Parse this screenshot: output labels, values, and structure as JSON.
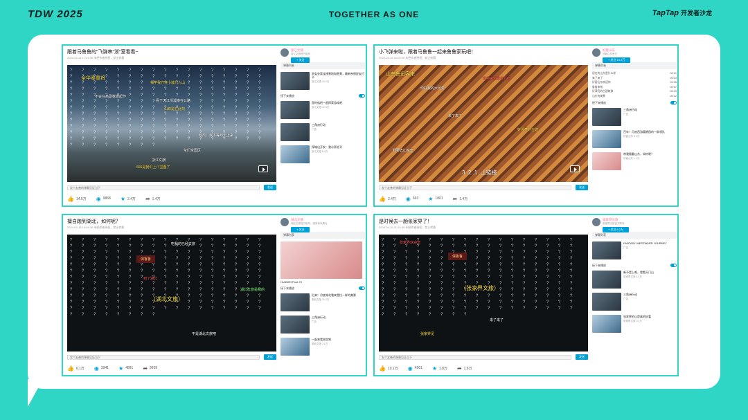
{
  "header": {
    "logo_left": "TDW 2025",
    "slogan": "TOGETHER AS ONE",
    "logo_right": "TapTap",
    "logo_right_sub": "开发者沙龙"
  },
  "panels": [
    {
      "title": "跟着马鲁鲁的\"飞弹串\"浙\"室看看~",
      "meta": "2024-04-18 17:33:38  未经作者授权，禁止转载",
      "danmaku": [
        "全华秦重将",
        "不会在高副数据起作",
        "我学我守住小城几人山",
        "看于天江浙溪淋在公路",
        "山峰是在此刻",
        "秋风，我不等到天上来",
        "666是我们上八宝图了",
        "爷们全国区",
        "浙江文旅!"
      ],
      "send_placeholder": "发个友善的弹幕见证当下",
      "send_label": "发送",
      "likes": "14.5万",
      "coins": "9868",
      "favs": "2.4万",
      "shares": "1.4万",
      "uploader": "浙江文旅",
      "uploader_desc": "浙江文旅官方账号",
      "follow": "+ 关注",
      "list_header": "弹幕列表",
      "autoplay": "接下来播放",
      "recs": [
        {
          "title": "浙女坐索连接景地和胜景，最新亲朋好友打卡",
          "sub": "浙江文旅  10.2万"
        },
        {
          "title": "是时候把一起探索游戏吧",
          "sub": "浙江文旅  12.3万"
        },
        {
          "title": "三角洲行动",
          "sub": "广告"
        },
        {
          "title": "探城出开发：我水原北寻",
          "sub": "浙江文旅  6.3万"
        }
      ]
    },
    {
      "title": "小飞弹来啦，跟着马鲁鲁一起来鲁鲁家玩吧！",
      "meta": "2024-04-19 18:00:00  未经作者授权，禁止转载",
      "danmaku": [
        "山东鲁迅客来",
        "你好我的大可爱",
        "欢迎来到曲阜孔府",
        "来了来了",
        "好漂亮的古建",
        "3..2..1..上链接",
        "我要去山东玩"
      ],
      "send_placeholder": "发个友善的弹幕见证当下",
      "send_label": "发送",
      "likes": "2.4万",
      "coins": "693",
      "favs": "1801",
      "shares": "1.4万",
      "uploader": "好客山东",
      "uploader_desc": "好客山东官方",
      "follow": "+ 关注 19.2万",
      "list_header": "弹幕列表",
      "autoplay": "接下来播放",
      "danmu_items": [
        {
          "text": "现在的山东是什么样",
          "time": "00:01"
        },
        {
          "text": "来了来了",
          "time": "00:03"
        },
        {
          "text": "好客山东欢迎你",
          "time": "00:05"
        },
        {
          "text": "鲁鲁来啦",
          "time": "00:07"
        },
        {
          "text": "好漂亮的古建筑群",
          "time": "00:09"
        },
        {
          "text": "山东有美景",
          "time": "00:12"
        }
      ],
      "recs": [
        {
          "title": "三角洲行动",
          "sub": "广告"
        },
        {
          "title": "百年！月底西游喜鹊园的一群领队",
          "sub": "好客山东  3.2万"
        },
        {
          "title": "带我看看山东，如何呢？",
          "sub": "好客山东  1.1万"
        }
      ]
    },
    {
      "title": "擅自跑到湖北，如何呢？",
      "meta": "2024-04-18 19:04:38  未经作者授权，禁止转载",
      "danmaku": [
        "保鲁鲁",
        "（湖北文旅）",
        "吃我的已经文旅",
        "到了湖北",
        "不是湖北文旅吧",
        "湖北文旅是我的"
      ],
      "send_placeholder": "发个友善的弹幕见证当下",
      "send_label": "发送",
      "likes": "6.1万",
      "coins": "3941",
      "favs": "4891",
      "shares": "9939",
      "uploader": "湖北文旅",
      "uploader_desc": "湖北文旅官方账号，邀请你来湖北",
      "follow": "+ 关注",
      "list_header": "弹幕列表",
      "autoplay": "接下来播放",
      "recs": [
        {
          "title": "HUAWEI Pura 70",
          "sub": "广告"
        },
        {
          "title": "后来！月底湖北看来是拉一样的美景",
          "sub": "湖北文旅  10.2万"
        },
        {
          "title": "三角洲行动",
          "sub": "广告"
        },
        {
          "title": "一起来看湖北吧",
          "sub": "湖北文旅  2.1万"
        }
      ]
    },
    {
      "title": "是时候去一趟张家界了！",
      "meta": "2024-04-19 21:10:38  未经作者授权，禁止转载",
      "danmaku": [
        "保鲁鲁",
        "（张家界文旅）",
        "张家界欢迎您",
        "来了来了",
        "张家界见"
      ],
      "send_placeholder": "发个友善的弹幕见证当下",
      "send_label": "发送",
      "likes": "10.1万",
      "coins": "4261",
      "favs": "1.8万",
      "shares": "1.6万",
      "uploader": "张家界文旅",
      "uploader_desc": "张家界文旅官方账号",
      "follow": "+ 关注 8.2万",
      "list_header": "弹幕列表",
      "autoplay": "接下来播放",
      "recs": [
        {
          "title": "FANTASY WESTWARD JOURNEY",
          "sub": "广告"
        },
        {
          "title": "新不是上吧，看看天门山",
          "sub": "张家界文旅  4.3万"
        },
        {
          "title": "三角洲行动",
          "sub": "广告"
        },
        {
          "title": "张家界的山是真的好看",
          "sub": "张家界文旅  2.2万"
        }
      ]
    }
  ],
  "qmark_text": "? ? ? ? ? ? ? ? ? ? ? ? ? ? ? ? ? ? ? ? ? ? ? ? ? ? ? ? ? ? ? ? ? ? ? ? ? ? ? ? ? ? ? ? ? ? ? ? ? ? ? ? ? ? ? ? ? ? ? ? ? ? ? ? ? ? ? ? ? ? ? ? ? ? ? ? ? ? ? ? ? ? ? ? ? ? ? ? ? ? ? ? ? ? ? ? ? ? ? ? ? ? ? ? ? ? ? ? ? ? ? ? ? ? ? ? ? ? ? ? ? ? ? ? ? ? ? ? ? ? ? ? ? ? ? ? ? ? ? ? ? ? ? ? ? ? ? ? ? ? ? ? ? ? ? ? ? ? ? ? ? ? ? ? ? ? ? ? ? ? ? ? ? ? ? ? ? ? ? ? ? ? ? ? ? ? ? ? ? ? ? ? ? ? ? ? ? ? ? ? ? ? ? ? ? ? ? ? ? ? ? ?"
}
